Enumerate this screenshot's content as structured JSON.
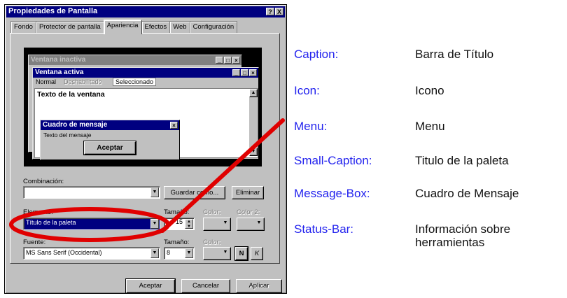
{
  "dialog": {
    "title": "Propiedades de Pantalla",
    "title_buttons": [
      "?",
      "X"
    ],
    "tabs": [
      "Fondo",
      "Protector de pantalla",
      "Apariencia",
      "Efectos",
      "Web",
      "Configuración"
    ],
    "active_tab": "Apariencia"
  },
  "preview": {
    "inactive_title": "Ventana inactiva",
    "active_title": "Ventana activa",
    "menu": {
      "normal": "Normal",
      "disabled": "Deshabilitado",
      "selected": "Seleccionado"
    },
    "window_text": "Texto de la ventana",
    "message_box": {
      "title": "Cuadro de mensaje",
      "text": "Texto del mensaje",
      "button": "Aceptar"
    }
  },
  "scheme": {
    "label": "Combinación:",
    "value": "",
    "save_button": "Guardar como...",
    "delete_button": "Eliminar"
  },
  "item": {
    "label": "Elemento:",
    "value": "Título de la paleta",
    "size_label": "Tamaño:",
    "size_value": "15",
    "color_label": "Color:",
    "color2_label": "Color 2:"
  },
  "font": {
    "label": "Fuente:",
    "value": "MS Sans Serif (Occidental)",
    "size_label": "Tamaño:",
    "size_value": "8",
    "color_label": "Color:",
    "bold_label": "N",
    "italic_label": "K"
  },
  "buttons": {
    "ok": "Aceptar",
    "cancel": "Cancelar",
    "apply": "Aplicar"
  },
  "legend": [
    {
      "key": "Caption:",
      "value": "Barra de Título"
    },
    {
      "key": "Icon:",
      "value": "Icono"
    },
    {
      "key": "Menu:",
      "value": "Menu"
    },
    {
      "key": "Small-Caption:",
      "value": "Titulo de la paleta"
    },
    {
      "key": "Message-Box:",
      "value": "Cuadro de Mensaje"
    },
    {
      "key": "Status-Bar:",
      "value": "Información sobre",
      "value2": "herramientas"
    }
  ],
  "colors": {
    "active_caption": "#000080",
    "inactive_caption": "#808080",
    "legend_key": "#2323ee",
    "annotation": "#e00000"
  }
}
